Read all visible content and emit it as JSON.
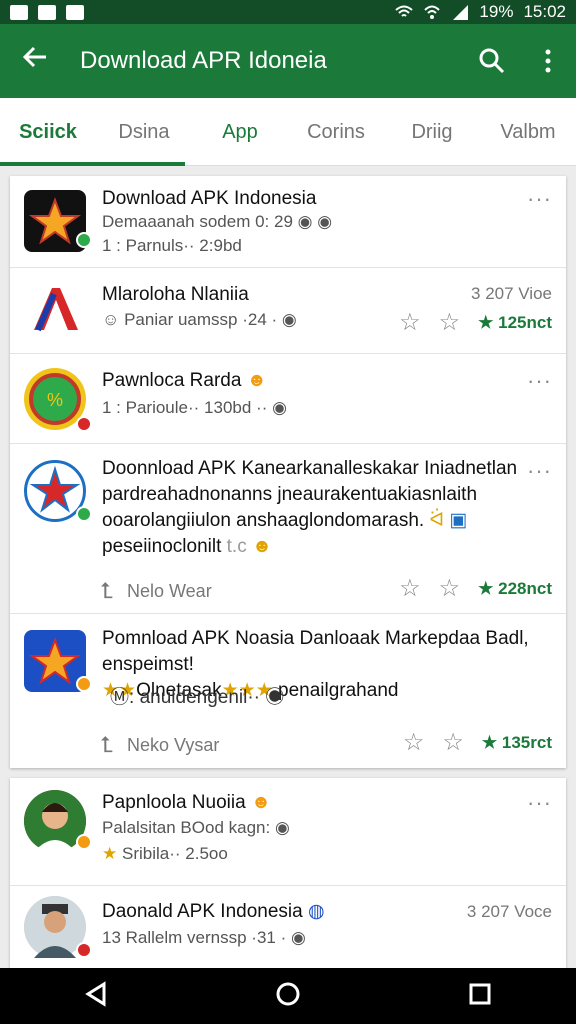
{
  "status_bar": {
    "battery": "19%",
    "time": "15:02"
  },
  "app_bar": {
    "title": "Download APR Idoneia"
  },
  "tabs": [
    {
      "label": "Sciick"
    },
    {
      "label": "Dsina"
    },
    {
      "label": "App"
    },
    {
      "label": "Corins"
    },
    {
      "label": "Driig"
    },
    {
      "label": "Valbm"
    }
  ],
  "rows": [
    {
      "name": "Download APK Indonesia",
      "sub1": "Demaaanah sodem 0: 29",
      "sub2": "1 : Parnuls·· 2:9bd",
      "more": "···"
    },
    {
      "name": "Mlaroloha Nlaniia",
      "sub1": "Paniar uamssp ·24 ·",
      "meta": "3 207 Vioe",
      "rating": "125nct"
    },
    {
      "name": "Pawnloca Rarda",
      "sub1": "1 : Parioule·· 130bd ··",
      "more": "···"
    },
    {
      "body": "Doonnload APK Kanearkanalleskakar Iniadnetlan pardreahadnonanns jneaurakentuakiasnlaith ooarolangiiulon anshaaglondomarash. ",
      "body2": "peseiinoclonilt",
      "share": "Nelo Wear",
      "rating": "228nct",
      "more": "···"
    },
    {
      "body": "Pomnload APK Noasia Danloaak Markepdaa Badl, enspeimst!",
      "body_gold": "Olnetasak",
      "body_end": "penailgrahand",
      "sub": "anuldengenil··",
      "share": "Neko Vysar",
      "rating": "135rct"
    },
    {
      "name": "Papnloola Nuoiia",
      "sub1": "Palalsitan BOod kagn:",
      "sub2": "Sribila·· 2.5oo",
      "more": "···"
    },
    {
      "name": "Daonald APK Indonesia",
      "sub1": "13 Rallelm vernssp ·31 ·",
      "meta": "3 207 Voce"
    }
  ],
  "colors": {
    "primary": "#1b7a3a",
    "status": "#134d28",
    "star": "#e0a400"
  }
}
